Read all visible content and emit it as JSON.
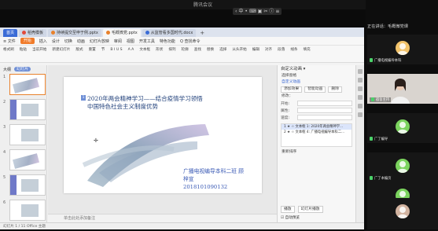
{
  "meeting": {
    "title": "腾讯会议",
    "controls": [
      "‹",
      "中",
      "•",
      "⌨",
      "▣",
      "✂",
      "ⓘ",
      "≡"
    ]
  },
  "wps": {
    "tabs": [
      {
        "label": "首页",
        "kind": "home"
      },
      {
        "label": "稻壳模板",
        "dot": "#e24a3b"
      },
      {
        "label": "持续提交至申于例.pptx",
        "dot": "#e8812c"
      },
      {
        "label": "毛概微党.pptx",
        "dot": "#e8812c",
        "active": true
      },
      {
        "label": "从监管看多国时代.docx",
        "dot": "#3a6bd6"
      }
    ],
    "new_tab": "+",
    "menu": [
      "≡ 文件",
      "开始",
      "插入",
      "设计",
      "切换",
      "动画",
      "幻灯片放映",
      "审阅",
      "视图",
      "开发工具",
      "特色功能",
      "Q 查找命令"
    ],
    "toolbar": [
      "格式刷",
      "粘贴",
      "当前开始",
      "新建幻灯片",
      "版式",
      "重置",
      "节",
      "B I U S",
      "A A",
      "文本框",
      "形状",
      "排列",
      "轮廓",
      "查找",
      "替换",
      "选择",
      "从头开始",
      "编辑",
      "对齐",
      "段落",
      "线条",
      "填充"
    ],
    "thumb_pane": {
      "tab_outline": "大纲",
      "tab_slides": "幻灯片"
    },
    "thumbnails": [
      "1",
      "2",
      "3",
      "4",
      "5",
      "6"
    ],
    "slide": {
      "number": "1",
      "title_line1": "2020年两会精神学习——结合疫情学习领悟",
      "title_line2": "中国特色社会主义制度优势",
      "author_line1": "广播电视编导本科二班 顾",
      "author_line2": "梓宣",
      "author_line3": "2018101090132"
    },
    "notes_placeholder": "单击此处添加备注",
    "status": "幻灯片 1 / 11   Office 主题",
    "anim_pane": {
      "header": "自定义动画 ▾",
      "select_pane": "选择窗格",
      "section": "自定义动画",
      "add_effect": "添加效果",
      "smart_anim": "智能动画",
      "delete": "删除",
      "modify_label": "修改：",
      "start_label": "开始:",
      "property_label": "属性:",
      "speed_label": "速度:",
      "list": [
        "1 ★ ☆ 文本框 1: 2020年两会精神学...",
        "2 ★ ☆ 文本框 4: 广播电视编导本科二..."
      ],
      "reorder": "重新排序",
      "play": "播放",
      "slideshow": "幻灯片播放",
      "autopreview": "自动预览"
    }
  },
  "participants": {
    "header": "正在讲话：毛概微党课",
    "tiles": [
      {
        "name": "广播电视编导本科",
        "kind": "avatar"
      },
      {
        "name": "宿舍主持",
        "kind": "video"
      },
      {
        "name": "广了编导",
        "kind": "avatar"
      },
      {
        "name": "广了本编页",
        "kind": "avatar"
      },
      {
        "name": "广了本科",
        "kind": "avatar"
      },
      {
        "name": "",
        "kind": "avatar"
      }
    ]
  }
}
